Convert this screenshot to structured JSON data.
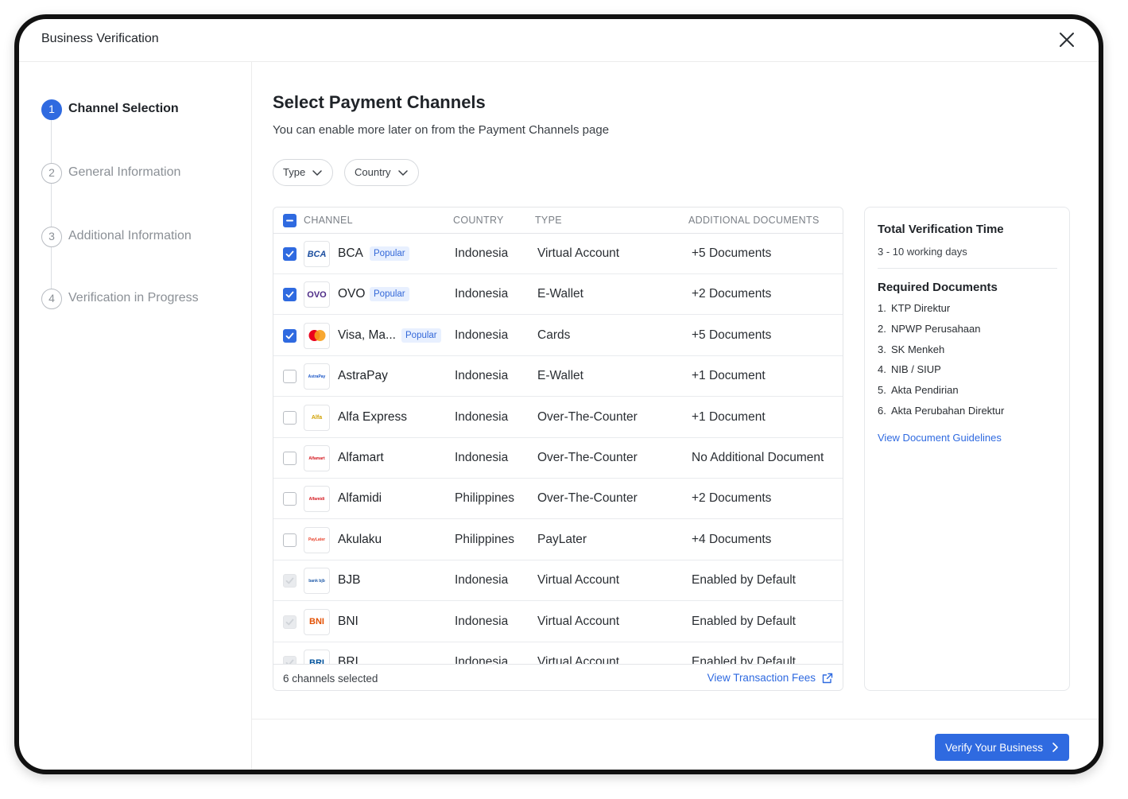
{
  "modal": {
    "title": "Business Verification"
  },
  "stepper": {
    "steps": [
      {
        "number": "1",
        "label": "Channel Selection",
        "state": "active"
      },
      {
        "number": "2",
        "label": "General Information",
        "state": "pending"
      },
      {
        "number": "3",
        "label": "Additional Information",
        "state": "pending"
      },
      {
        "number": "4",
        "label": "Verification in Progress",
        "state": "pending"
      }
    ]
  },
  "main": {
    "title": "Select Payment Channels",
    "subtitle": "You can enable more later on from the Payment Channels page",
    "filters": {
      "type_label": "Type",
      "country_label": "Country"
    }
  },
  "table": {
    "columns": [
      "CHANNEL",
      "COUNTRY",
      "TYPE",
      "ADDITIONAL DOCUMENTS"
    ],
    "popular_label": "Popular",
    "rows": [
      {
        "name": "BCA",
        "country": "Indonesia",
        "type": "Virtual Account",
        "docs": "+5 Documents",
        "state": "checked",
        "popular": true,
        "logo_text": "BCA",
        "logo_color": "#1d4fa0"
      },
      {
        "name": "OVO",
        "country": "Indonesia",
        "type": "E-Wallet",
        "docs": "+2 Documents",
        "state": "checked",
        "popular": true,
        "logo_text": "OVO",
        "logo_color": "#4c2a86"
      },
      {
        "name": "Visa, Ma...",
        "country": "Indonesia",
        "type": "Cards",
        "docs": "+5 Documents",
        "state": "checked",
        "popular": true,
        "logo_text": "",
        "logo_color": "#eb001b"
      },
      {
        "name": "AstraPay",
        "country": "Indonesia",
        "type": "E-Wallet",
        "docs": "+1 Document",
        "state": "unchecked",
        "popular": false,
        "logo_text": "AstraPay",
        "logo_color": "#1c57c7"
      },
      {
        "name": "Alfa Express",
        "country": "Indonesia",
        "type": "Over-The-Counter",
        "docs": "+1 Document",
        "state": "unchecked",
        "popular": false,
        "logo_text": "Alfa",
        "logo_color": "#d0a000"
      },
      {
        "name": "Alfamart",
        "country": "Indonesia",
        "type": "Over-The-Counter",
        "docs": "No Additional Document",
        "state": "unchecked",
        "popular": false,
        "logo_text": "Alfamart",
        "logo_color": "#d4161d"
      },
      {
        "name": "Alfamidi",
        "country": "Philippines",
        "type": "Over-The-Counter",
        "docs": "+2 Documents",
        "state": "unchecked",
        "popular": false,
        "logo_text": "Alfamidi",
        "logo_color": "#d4161d"
      },
      {
        "name": "Akulaku",
        "country": "Philippines",
        "type": "PayLater",
        "docs": "+4 Documents",
        "state": "unchecked",
        "popular": false,
        "logo_text": "PayLater",
        "logo_color": "#e8412b"
      },
      {
        "name": "BJB",
        "country": "Indonesia",
        "type": "Virtual Account",
        "docs": "Enabled by Default",
        "state": "disabled",
        "popular": false,
        "logo_text": "bank bjb",
        "logo_color": "#1f5aa8"
      },
      {
        "name": "BNI",
        "country": "Indonesia",
        "type": "Virtual Account",
        "docs": "Enabled by Default",
        "state": "disabled",
        "popular": false,
        "logo_text": "BNI",
        "logo_color": "#e35205"
      },
      {
        "name": "BRI",
        "country": "Indonesia",
        "type": "Virtual Account",
        "docs": "Enabled by Default",
        "state": "disabled",
        "popular": false,
        "logo_text": "BRI",
        "logo_color": "#00529c"
      }
    ],
    "footer": {
      "selected_text": "6 channels selected",
      "fees_link": "View Transaction Fees"
    }
  },
  "side": {
    "time_title": "Total Verification Time",
    "time_value": "3 - 10 working days",
    "docs_title": "Required Documents",
    "docs": [
      "KTP Direktur",
      "NPWP Perusahaan",
      "SK Menkeh",
      "NIB / SIUP",
      "Akta Pendirian",
      "Akta Perubahan Direktur"
    ],
    "guidelines_link": "View Document Guidelines"
  },
  "footer": {
    "verify_label": "Verify Your Business"
  },
  "colors": {
    "accent": "#2f6ae0",
    "popular_bg": "#e8f0ff"
  }
}
